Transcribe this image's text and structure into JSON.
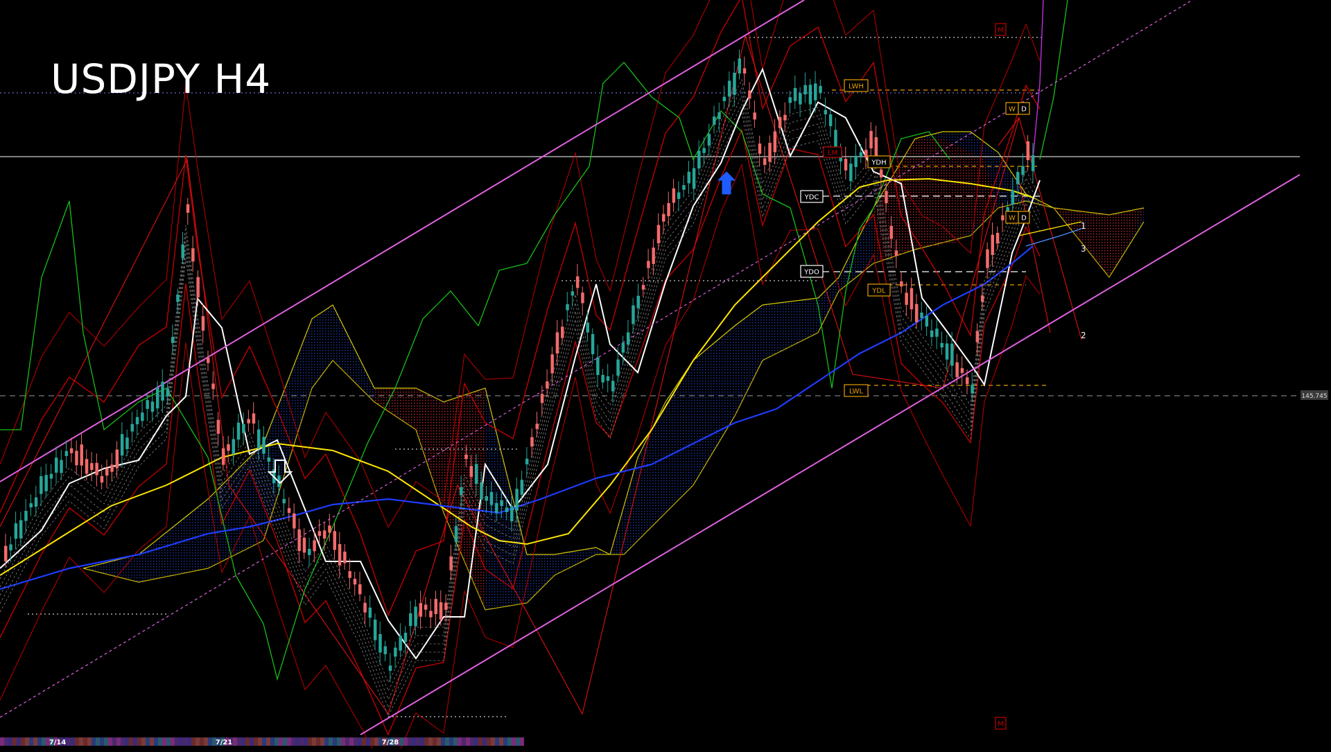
{
  "title": "USDJPY H4",
  "price_label": "145.745",
  "date_labels": [
    "7/14",
    "7/21",
    "7/28"
  ],
  "level_labels": {
    "lwh": "LWH",
    "lwl": "LWL",
    "ydh": "YDH",
    "ydl": "YDL",
    "ydc": "YDC",
    "ydo": "YDO",
    "lm": "LM",
    "m_top": "M",
    "m_bottom": "M",
    "w_top": "W",
    "d_top": "D",
    "w_mid": "W",
    "d_mid": "D"
  },
  "wave_labels": [
    "1",
    "3",
    "2"
  ],
  "colors": {
    "background": "#000000",
    "bull_candle": "#26a69a",
    "bear_candle": "#f26b6b",
    "channel": "#e060e0",
    "kumo_bull": "#2040c0",
    "kumo_bear": "#c02020",
    "ma_white": "#ffffff",
    "ma_yellow": "#ffe600",
    "ma_blue": "#1e3cff",
    "bollinger": "#cc0000",
    "chikou": "#16c016",
    "level_box": "#e8a000"
  },
  "chart_data": {
    "type": "candlestick",
    "symbol": "USDJPY",
    "timeframe": "H4",
    "x_ticks": [
      "7/14",
      "7/21",
      "7/28"
    ],
    "current_price_marker": "145.745",
    "indicators": [
      "ichimoku",
      "bollinger",
      "moving averages",
      "price channel"
    ]
  }
}
